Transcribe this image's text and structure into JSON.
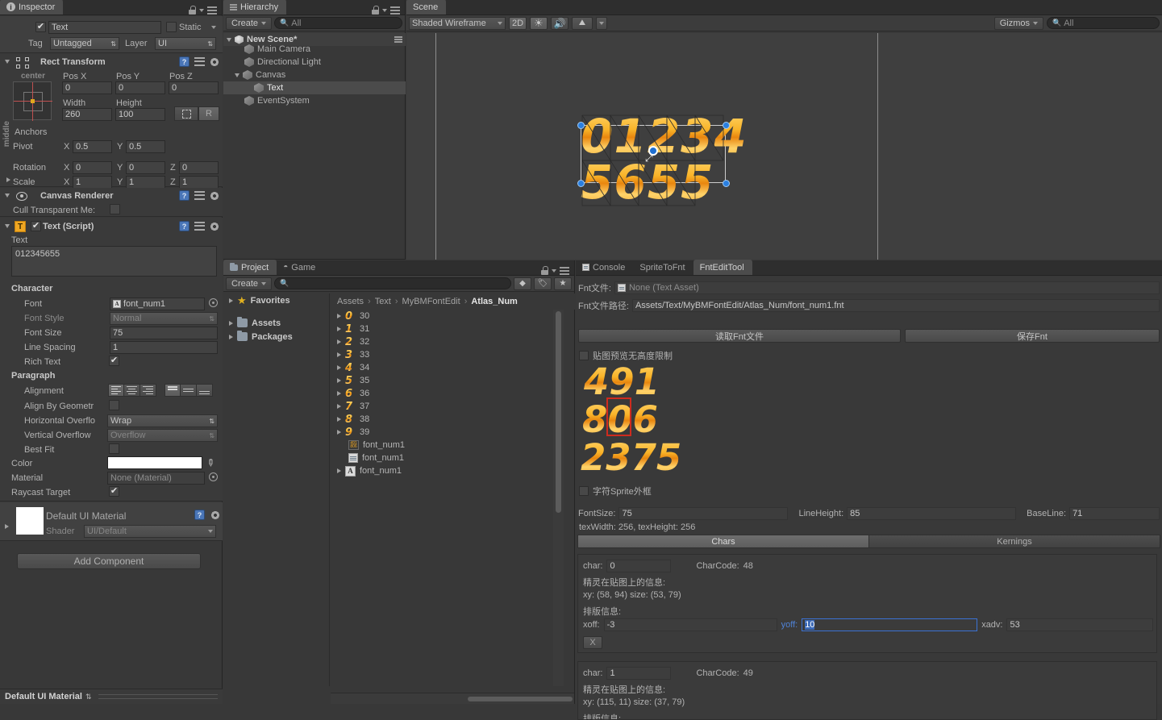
{
  "inspector": {
    "tab": "Inspector",
    "object_name": "Text",
    "object_enabled": true,
    "static_label": "Static",
    "tag_label": "Tag",
    "tag_value": "Untagged",
    "layer_label": "Layer",
    "layer_value": "UI",
    "rect_transform": {
      "title": "Rect Transform",
      "anchor_preset_top": "center",
      "anchor_preset_left": "middle",
      "pos_x_label": "Pos X",
      "pos_x": "0",
      "pos_y_label": "Pos Y",
      "pos_y": "0",
      "pos_z_label": "Pos Z",
      "pos_z": "0",
      "width_label": "Width",
      "width": "260",
      "height_label": "Height",
      "height": "100",
      "blueprint_label": "R",
      "anchors_label": "Anchors",
      "pivot_label": "Pivot",
      "pivot_x": "0.5",
      "pivot_y": "0.5",
      "rotation_label": "Rotation",
      "rot_x": "0",
      "rot_y": "0",
      "rot_z": "0",
      "scale_label": "Scale",
      "scale_x": "1",
      "scale_y": "1",
      "scale_z": "1",
      "x_label": "X",
      "y_label": "Y",
      "z_label": "Z"
    },
    "canvas_renderer": {
      "title": "Canvas Renderer",
      "cull_label": "Cull Transparent Me:",
      "cull_value": false
    },
    "text_script": {
      "title": "Text (Script)",
      "enabled": true,
      "text_label": "Text",
      "text_value": "012345655",
      "character_header": "Character",
      "font_label": "Font",
      "font_value": "font_num1",
      "font_style_label": "Font Style",
      "font_style_value": "Normal",
      "font_size_label": "Font Size",
      "font_size_value": "75",
      "line_spacing_label": "Line Spacing",
      "line_spacing_value": "1",
      "rich_text_label": "Rich Text",
      "rich_text_value": true,
      "paragraph_header": "Paragraph",
      "alignment_label": "Alignment",
      "align_by_geometry_label": "Align By Geometr",
      "align_by_geometry_value": false,
      "horizontal_overflow_label": "Horizontal Overflo",
      "horizontal_overflow_value": "Wrap",
      "vertical_overflow_label": "Vertical Overflow",
      "vertical_overflow_value": "Overflow",
      "best_fit_label": "Best Fit",
      "best_fit_value": false,
      "color_label": "Color",
      "color_value": "#FFFFFF",
      "material_label": "Material",
      "material_value": "None (Material)",
      "raycast_target_label": "Raycast Target",
      "raycast_target_value": true
    },
    "material_block": {
      "title": "Default UI Material",
      "shader_label": "Shader",
      "shader_value": "UI/Default"
    },
    "add_component_label": "Add Component",
    "status_bar": "Default UI Material"
  },
  "hierarchy": {
    "tab": "Hierarchy",
    "create_label": "Create",
    "search_placeholder": "All",
    "scene_name": "New Scene*",
    "items": [
      {
        "label": "Main Camera",
        "depth": 1,
        "expandable": false,
        "selected": false
      },
      {
        "label": "Directional Light",
        "depth": 1,
        "expandable": false,
        "selected": false
      },
      {
        "label": "Canvas",
        "depth": 1,
        "expandable": true,
        "selected": false
      },
      {
        "label": "Text",
        "depth": 2,
        "expandable": false,
        "selected": true
      },
      {
        "label": "EventSystem",
        "depth": 1,
        "expandable": false,
        "selected": false
      }
    ]
  },
  "scene": {
    "tab": "Scene",
    "draw_mode": "Shaded Wireframe",
    "mode_2d": "2D",
    "gizmos_label": "Gizmos",
    "gizmos_search_placeholder": "All",
    "canvas_text_line1": "01234",
    "canvas_text_line2": "5655"
  },
  "project": {
    "tab_project": "Project",
    "tab_game": "Game",
    "create_label": "Create",
    "search_placeholder": "",
    "tree": [
      {
        "label": "Favorites",
        "icon": "star-icon",
        "expandable": true
      },
      {
        "label": "Assets",
        "icon": "folder-icon",
        "expandable": true
      },
      {
        "label": "Packages",
        "icon": "folder-icon",
        "expandable": true
      }
    ],
    "breadcrumb": [
      "Assets",
      "Text",
      "MyBMFontEdit",
      "Atlas_Num"
    ],
    "files": [
      {
        "glyph": "0",
        "label": "30",
        "type": "sprite",
        "expandable": true
      },
      {
        "glyph": "1",
        "label": "31",
        "type": "sprite",
        "expandable": true
      },
      {
        "glyph": "2",
        "label": "32",
        "type": "sprite",
        "expandable": true
      },
      {
        "glyph": "3",
        "label": "33",
        "type": "sprite",
        "expandable": true
      },
      {
        "glyph": "4",
        "label": "34",
        "type": "sprite",
        "expandable": true
      },
      {
        "glyph": "5",
        "label": "35",
        "type": "sprite",
        "expandable": true
      },
      {
        "glyph": "6",
        "label": "36",
        "type": "sprite",
        "expandable": true
      },
      {
        "glyph": "7",
        "label": "37",
        "type": "sprite",
        "expandable": true
      },
      {
        "glyph": "8",
        "label": "38",
        "type": "sprite",
        "expandable": true
      },
      {
        "glyph": "9",
        "label": "39",
        "type": "sprite",
        "expandable": true
      },
      {
        "glyph": "",
        "label": "font_num1",
        "type": "texture",
        "expandable": false
      },
      {
        "glyph": "",
        "label": "font_num1",
        "type": "textasset",
        "expandable": false
      },
      {
        "glyph": "",
        "label": "font_num1",
        "type": "font",
        "expandable": true
      }
    ]
  },
  "fnt_tool": {
    "tab_console": "Console",
    "tab_sprite_to_fnt": "SpriteToFnt",
    "tab_fnt_edit": "FntEditTool",
    "fnt_file_label": "Fnt文件:",
    "fnt_file_value": "None (Text Asset)",
    "fnt_path_label": "Fnt文件路径:",
    "fnt_path_value": "Assets/Text/MyBMFontEdit/Atlas_Num/font_num1.fnt",
    "read_button": "读取Fnt文件",
    "save_button": "保存Fnt",
    "preview_no_height_limit_label": "贴图预览无高度限制",
    "preview_no_height_limit_value": false,
    "atlas_rows": [
      "491",
      "806",
      "2375"
    ],
    "sprite_outline_label": "字符Sprite外框",
    "sprite_outline_value": false,
    "font_size_label": "FontSize:",
    "font_size_value": "75",
    "line_height_label": "LineHeight:",
    "line_height_value": "85",
    "base_line_label": "BaseLine:",
    "base_line_value": "71",
    "tex_dims": "texWidth: 256, texHeight: 256",
    "tab_chars": "Chars",
    "tab_kernings": "Kernings",
    "chars": [
      {
        "char_label": "char:",
        "char_value": "0",
        "charcode_label": "CharCode:",
        "charcode_value": "48",
        "sprite_info_header": "精灵在贴图上的信息:",
        "sprite_info": "xy: (58, 94) size: (53, 79)",
        "layout_info_header": "排版信息:",
        "xoff_label": "xoff:",
        "xoff_value": "-3",
        "yoff_label": "yoff:",
        "yoff_value": "10",
        "yoff_focused": true,
        "xadv_label": "xadv:",
        "xadv_value": "53",
        "delete_label": "X"
      },
      {
        "char_label": "char:",
        "char_value": "1",
        "charcode_label": "CharCode:",
        "charcode_value": "49",
        "sprite_info_header": "精灵在贴图上的信息:",
        "sprite_info": "xy: (115, 11) size: (37, 79)",
        "layout_info_header": "排版信息:"
      }
    ]
  },
  "colors": {
    "accent_blue": "#3a72c8",
    "panel_bg": "#383838",
    "selection": "#4b4b4b",
    "gold": "#f0a722"
  }
}
